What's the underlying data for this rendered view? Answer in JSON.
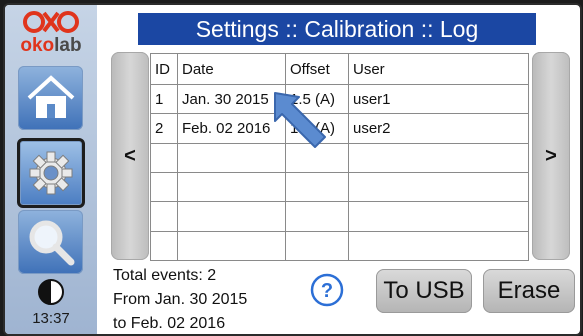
{
  "brand": {
    "logo_prefix": "oko",
    "logo_suffix": "lab",
    "color_red": "#e0341c"
  },
  "sidebar": {
    "items": [
      {
        "name": "home",
        "icon": "home-icon",
        "active": false
      },
      {
        "name": "settings",
        "icon": "gear-icon",
        "active": true
      },
      {
        "name": "search",
        "icon": "magnifier-icon",
        "active": false
      }
    ],
    "theme_icon": "contrast-icon",
    "time": "13:37"
  },
  "header": {
    "title": "Settings :: Calibration :: Log",
    "color": "#1b47a3"
  },
  "nav": {
    "prev_label": "<",
    "next_label": ">"
  },
  "table": {
    "columns": [
      "ID",
      "Date",
      "Offset",
      "User"
    ],
    "rows": [
      [
        "1",
        "Jan. 30 2015",
        "1.5 (A)",
        "user1"
      ],
      [
        "2",
        "Feb. 02 2016",
        "1.5 (A)",
        "user2"
      ],
      [
        "",
        "",
        "",
        ""
      ],
      [
        "",
        "",
        "",
        ""
      ],
      [
        "",
        "",
        "",
        ""
      ],
      [
        "",
        "",
        "",
        ""
      ]
    ]
  },
  "summary": {
    "total": "Total events: 2",
    "from": "From Jan. 30 2015",
    "to": "to Feb. 02 2016"
  },
  "help_icon": "?",
  "buttons": {
    "usb": "To USB",
    "erase": "Erase"
  }
}
